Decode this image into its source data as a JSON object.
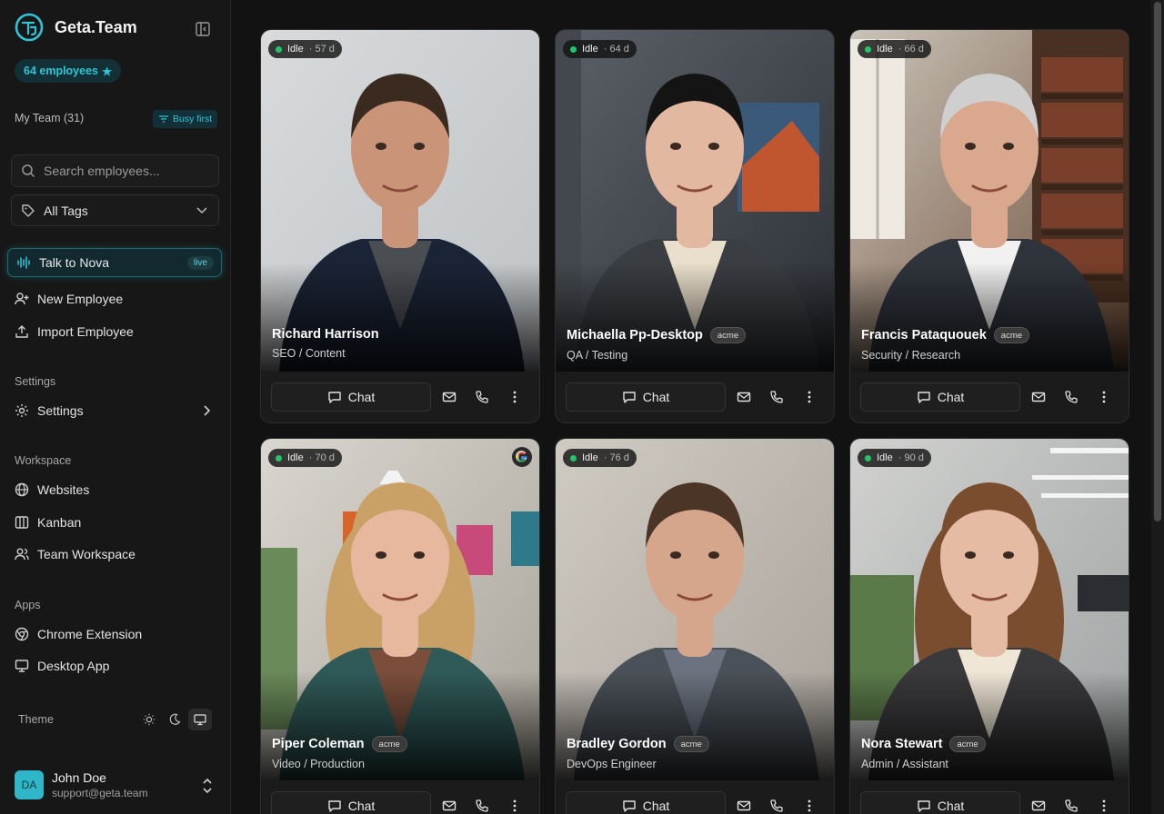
{
  "brand": {
    "name": "Geta.Team"
  },
  "sidebar": {
    "employee_badge": "64 employees",
    "my_team": "My Team (31)",
    "busy_first": "Busy first",
    "search_placeholder": "Search employees...",
    "tags_value": "All Tags",
    "talk": {
      "label": "Talk to Nova",
      "badge": "live"
    },
    "actions": [
      {
        "label": "New Employee",
        "icon": "user-plus-icon"
      },
      {
        "label": "Import Employee",
        "icon": "upload-icon"
      }
    ],
    "settings_section": "Settings",
    "settings_item": "Settings",
    "workspace_section": "Workspace",
    "workspace_items": [
      {
        "label": "Websites",
        "icon": "globe-icon"
      },
      {
        "label": "Kanban",
        "icon": "kanban-icon"
      },
      {
        "label": "Team Workspace",
        "icon": "users-icon"
      }
    ],
    "apps_section": "Apps",
    "apps_items": [
      {
        "label": "Chrome Extension",
        "icon": "chrome-icon"
      },
      {
        "label": "Desktop App",
        "icon": "monitor-icon"
      }
    ],
    "theme_label": "Theme",
    "user": {
      "initials": "DA",
      "name": "John Doe",
      "email": "support@geta.team"
    }
  },
  "employees": [
    {
      "name": "Richard Harrison",
      "role": "SEO / Content",
      "status": "Idle",
      "days": "57 d",
      "tag": ""
    },
    {
      "name": "Michaella Pp-Desktop",
      "role": "QA / Testing",
      "status": "Idle",
      "days": "64 d",
      "tag": "acme"
    },
    {
      "name": "Francis Pataquouek",
      "role": "Security / Research",
      "status": "Idle",
      "days": "66 d",
      "tag": "acme"
    },
    {
      "name": "Piper Coleman",
      "role": "Video / Production",
      "status": "Idle",
      "days": "70 d",
      "tag": "acme"
    },
    {
      "name": "Bradley Gordon",
      "role": "DevOps Engineer",
      "status": "Idle",
      "days": "76 d",
      "tag": "acme"
    },
    {
      "name": "Nora Stewart",
      "role": "Admin / Assistant",
      "status": "Idle",
      "days": "90 d",
      "tag": "acme"
    }
  ],
  "card_actions": {
    "chat_label": "Chat"
  },
  "colors": {
    "accent": "#2fc4d6",
    "status_idle": "#23c56b",
    "background": "#121212"
  }
}
